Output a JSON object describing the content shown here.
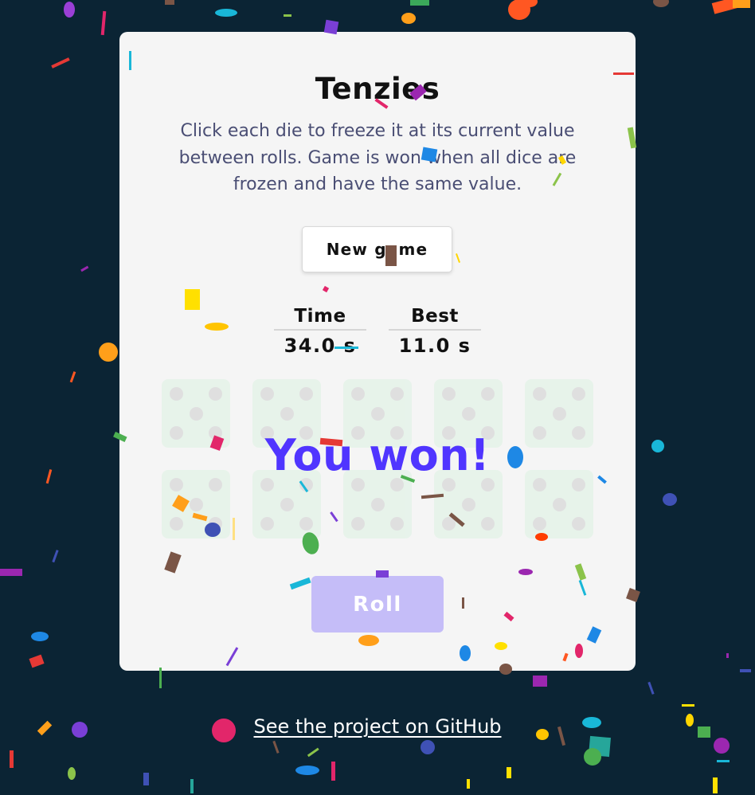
{
  "game": {
    "title": "Tenzies",
    "instructions": "Click each die to freeze it at its current value between rolls. Game is won when all dice are frozen and have the same value.",
    "new_game_label": "New game",
    "stats": {
      "time_label": "Time",
      "time_value": "34.0 s",
      "best_label": "Best",
      "best_value": "11.0 s"
    },
    "dice": [
      5,
      5,
      5,
      5,
      5,
      5,
      5,
      5,
      5,
      5
    ],
    "dice_all_frozen": true,
    "won_message": "You won!",
    "roll_label": "Roll",
    "roll_enabled": false
  },
  "footer": {
    "github_link": "See the project on GitHub"
  },
  "colors": {
    "background": "#0b2434",
    "card": "#f5f5f5",
    "accent": "#5035ff",
    "die_frozen": "#e4f3e8",
    "roll_disabled": "#c5bdf8"
  }
}
